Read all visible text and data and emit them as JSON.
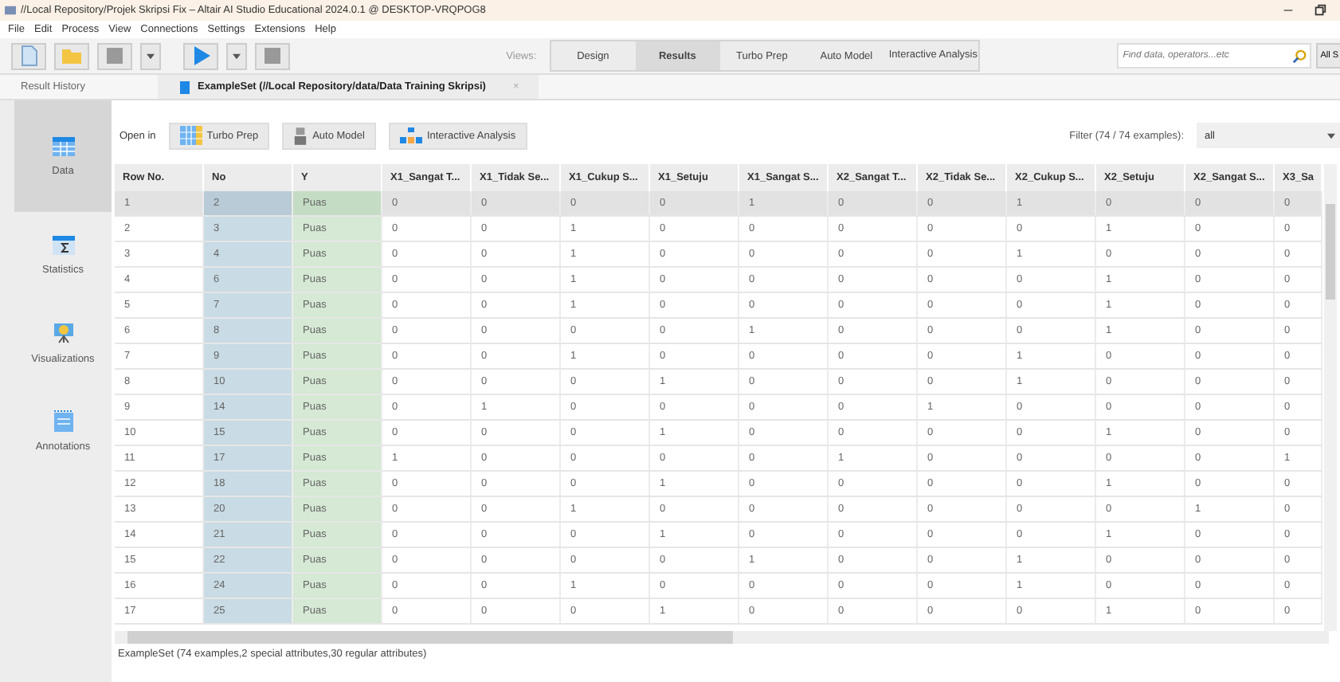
{
  "window": {
    "title": "//Local Repository/Projek Skripsi Fix – Altair AI Studio Educational 2024.0.1 @ DESKTOP-VRQPOG8"
  },
  "menu": [
    "File",
    "Edit",
    "Process",
    "View",
    "Connections",
    "Settings",
    "Extensions",
    "Help"
  ],
  "views": {
    "label": "Views:",
    "items": [
      {
        "label": "Design",
        "selected": false
      },
      {
        "label": "Results",
        "selected": true
      },
      {
        "label": "Turbo Prep",
        "selected": false
      },
      {
        "label": "Auto Model",
        "selected": false
      },
      {
        "label": "Interactive Analysis",
        "selected": false
      }
    ]
  },
  "search": {
    "placeholder": "Find data, operators...etc",
    "scope": "All S"
  },
  "tabs": [
    {
      "label": "Result History",
      "kind": "plain",
      "selected": false
    },
    {
      "label": "ExampleSet (//Local Repository/data/Data Training Skripsi)",
      "kind": "doc",
      "selected": true,
      "close": "×"
    }
  ],
  "sidebar": {
    "items": [
      {
        "label": "Data",
        "kind": "table",
        "selected": true
      },
      {
        "label": "Statistics",
        "kind": "sigma",
        "selected": false
      },
      {
        "label": "Visualizations",
        "kind": "chart",
        "selected": false
      },
      {
        "label": "Annotations",
        "kind": "note",
        "selected": false
      }
    ]
  },
  "open_in": {
    "label": "Open in",
    "buttons": [
      {
        "label": "Turbo Prep",
        "kind": "grid"
      },
      {
        "label": "Auto Model",
        "kind": "robot"
      },
      {
        "label": "Interactive Analysis",
        "kind": "tree"
      }
    ]
  },
  "filter": {
    "label": "Filter (74 / 74 examples):",
    "value": "all"
  },
  "table": {
    "columns": [
      {
        "label": "Row No.",
        "kind": "index"
      },
      {
        "label": "No",
        "kind": "id"
      },
      {
        "label": "Y",
        "kind": "label"
      },
      {
        "label": "X1_Sangat T...",
        "kind": "regular"
      },
      {
        "label": "X1_Tidak Se...",
        "kind": "regular"
      },
      {
        "label": "X1_Cukup S...",
        "kind": "regular"
      },
      {
        "label": "X1_Setuju",
        "kind": "regular"
      },
      {
        "label": "X1_Sangat S...",
        "kind": "regular"
      },
      {
        "label": "X2_Sangat T...",
        "kind": "regular"
      },
      {
        "label": "X2_Tidak Se...",
        "kind": "regular"
      },
      {
        "label": "X2_Cukup S...",
        "kind": "regular"
      },
      {
        "label": "X2_Setuju",
        "kind": "regular"
      },
      {
        "label": "X2_Sangat S...",
        "kind": "regular"
      },
      {
        "label": "X3_Sa",
        "kind": "regular"
      }
    ],
    "rows": [
      {
        "selected": true,
        "cells": [
          "1",
          "2",
          "Puas",
          "0",
          "0",
          "0",
          "0",
          "1",
          "0",
          "0",
          "1",
          "0",
          "0",
          "0"
        ]
      },
      {
        "selected": false,
        "cells": [
          "2",
          "3",
          "Puas",
          "0",
          "0",
          "1",
          "0",
          "0",
          "0",
          "0",
          "0",
          "1",
          "0",
          "0"
        ]
      },
      {
        "selected": false,
        "cells": [
          "3",
          "4",
          "Puas",
          "0",
          "0",
          "1",
          "0",
          "0",
          "0",
          "0",
          "1",
          "0",
          "0",
          "0"
        ]
      },
      {
        "selected": false,
        "cells": [
          "4",
          "6",
          "Puas",
          "0",
          "0",
          "1",
          "0",
          "0",
          "0",
          "0",
          "0",
          "1",
          "0",
          "0"
        ]
      },
      {
        "selected": false,
        "cells": [
          "5",
          "7",
          "Puas",
          "0",
          "0",
          "1",
          "0",
          "0",
          "0",
          "0",
          "0",
          "1",
          "0",
          "0"
        ]
      },
      {
        "selected": false,
        "cells": [
          "6",
          "8",
          "Puas",
          "0",
          "0",
          "0",
          "0",
          "1",
          "0",
          "0",
          "0",
          "1",
          "0",
          "0"
        ]
      },
      {
        "selected": false,
        "cells": [
          "7",
          "9",
          "Puas",
          "0",
          "0",
          "1",
          "0",
          "0",
          "0",
          "0",
          "1",
          "0",
          "0",
          "0"
        ]
      },
      {
        "selected": false,
        "cells": [
          "8",
          "10",
          "Puas",
          "0",
          "0",
          "0",
          "1",
          "0",
          "0",
          "0",
          "1",
          "0",
          "0",
          "0"
        ]
      },
      {
        "selected": false,
        "cells": [
          "9",
          "14",
          "Puas",
          "0",
          "1",
          "0",
          "0",
          "0",
          "0",
          "1",
          "0",
          "0",
          "0",
          "0"
        ]
      },
      {
        "selected": false,
        "cells": [
          "10",
          "15",
          "Puas",
          "0",
          "0",
          "0",
          "1",
          "0",
          "0",
          "0",
          "0",
          "1",
          "0",
          "0"
        ]
      },
      {
        "selected": false,
        "cells": [
          "11",
          "17",
          "Puas",
          "1",
          "0",
          "0",
          "0",
          "0",
          "1",
          "0",
          "0",
          "0",
          "0",
          "1"
        ]
      },
      {
        "selected": false,
        "cells": [
          "12",
          "18",
          "Puas",
          "0",
          "0",
          "0",
          "1",
          "0",
          "0",
          "0",
          "0",
          "1",
          "0",
          "0"
        ]
      },
      {
        "selected": false,
        "cells": [
          "13",
          "20",
          "Puas",
          "0",
          "0",
          "1",
          "0",
          "0",
          "0",
          "0",
          "0",
          "0",
          "1",
          "0"
        ]
      },
      {
        "selected": false,
        "cells": [
          "14",
          "21",
          "Puas",
          "0",
          "0",
          "0",
          "1",
          "0",
          "0",
          "0",
          "0",
          "1",
          "0",
          "0"
        ]
      },
      {
        "selected": false,
        "cells": [
          "15",
          "22",
          "Puas",
          "0",
          "0",
          "0",
          "0",
          "1",
          "0",
          "0",
          "1",
          "0",
          "0",
          "0"
        ]
      },
      {
        "selected": false,
        "cells": [
          "16",
          "24",
          "Puas",
          "0",
          "0",
          "1",
          "0",
          "0",
          "0",
          "0",
          "1",
          "0",
          "0",
          "0"
        ]
      },
      {
        "selected": false,
        "cells": [
          "17",
          "25",
          "Puas",
          "0",
          "0",
          "0",
          "1",
          "0",
          "0",
          "0",
          "0",
          "1",
          "0",
          "0"
        ]
      }
    ]
  },
  "status_bar": "ExampleSet (74 examples,2 special attributes,30 regular attributes)"
}
